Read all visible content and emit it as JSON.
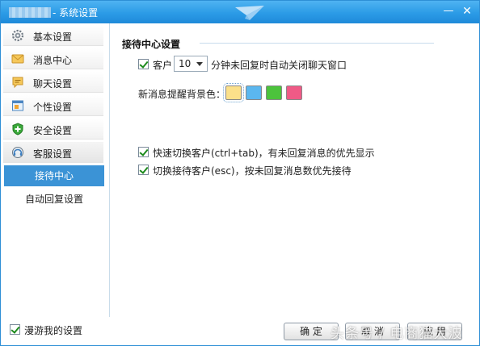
{
  "window": {
    "title": "- 系统设置",
    "minimize_glyph": "—",
    "close_glyph": "✕"
  },
  "sidebar": {
    "items": [
      {
        "label": "基本设置",
        "icon": "gear-icon"
      },
      {
        "label": "消息中心",
        "icon": "envelope-icon"
      },
      {
        "label": "聊天设置",
        "icon": "chat-bubble-icon"
      },
      {
        "label": "个性设置",
        "icon": "personalize-icon"
      },
      {
        "label": "安全设置",
        "icon": "shield-plus-icon"
      },
      {
        "label": "客服设置",
        "icon": "headset-icon"
      }
    ],
    "subitems": [
      {
        "label": "接待中心",
        "selected": true
      },
      {
        "label": "自动回复设置",
        "selected": false
      }
    ]
  },
  "content": {
    "section_title": "接待中心设置",
    "auto_close": {
      "checked": true,
      "prefix": "客户",
      "minutes_value": "10",
      "suffix": "分钟未回复时自动关闭聊天窗口"
    },
    "bg_color": {
      "label": "新消息提醒背景色：",
      "swatches": [
        {
          "color": "#fbe08a",
          "selected": true
        },
        {
          "color": "#5bb7ef",
          "selected": false
        },
        {
          "color": "#4cc33c",
          "selected": false
        },
        {
          "color": "#ef5a86",
          "selected": false
        }
      ]
    },
    "options": [
      {
        "checked": true,
        "label": "快速切换客户(ctrl+tab)，有未回复消息的优先显示"
      },
      {
        "checked": true,
        "label": "切换接待客户(esc)，按未回复消息数优先接待"
      }
    ]
  },
  "footer": {
    "roam_checked": true,
    "roam_label": "漫游我的设置",
    "ok_label": "确 定",
    "cancel_label": "取 消",
    "apply_label": "应 用"
  },
  "watermark": "头条号 / 电商猫大波"
}
